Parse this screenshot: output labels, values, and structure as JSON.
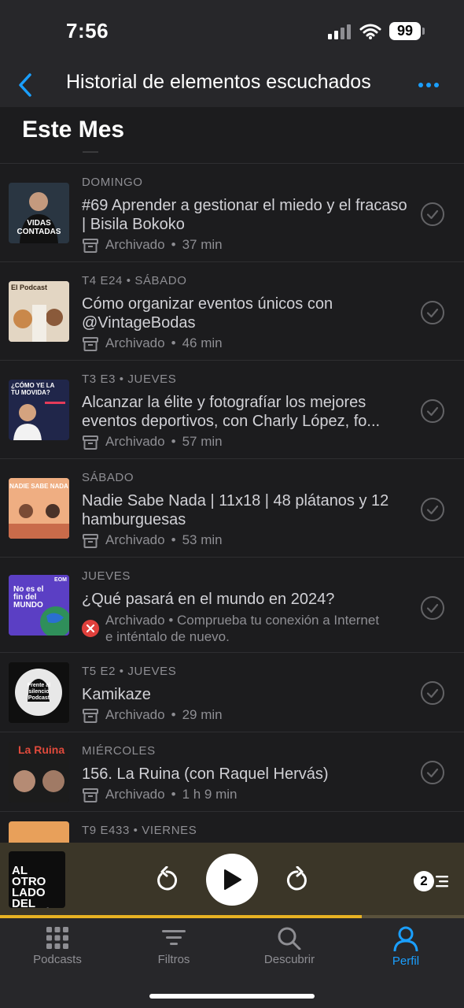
{
  "status_bar": {
    "time": "7:56",
    "battery": "99"
  },
  "nav": {
    "title": "Historial de elementos escuchados"
  },
  "section": {
    "title": "Este Mes"
  },
  "episodes": [
    {
      "meta": "DOMINGO",
      "title": "#69 Aprender a gestionar el miedo y el fracaso | Bisila Bokoko",
      "status": "Archivado",
      "duration": "37 min"
    },
    {
      "meta": "T4 E24 • SÁBADO",
      "title": "Cómo organizar eventos únicos con @VintageBodas",
      "status": "Archivado",
      "duration": "46 min"
    },
    {
      "meta": "T3 E3 • JUEVES",
      "title": "Alcanzar la élite y fotografíar los mejores eventos deportivos, con Charly López, fo...",
      "status": "Archivado",
      "duration": "57 min"
    },
    {
      "meta": "SÁBADO",
      "title": "Nadie Sabe Nada | 11x18 | 48 plátanos y 12 hamburguesas",
      "status": "Archivado",
      "duration": "53 min"
    },
    {
      "meta": "JUEVES",
      "title": "¿Qué pasará en el mundo en 2024?",
      "status": "Archivado",
      "error": "Comprueba tu conexión a Internet e inténtalo de nuevo."
    },
    {
      "meta": "T5 E2 • JUEVES",
      "title": "Kamikaze",
      "status": "Archivado",
      "duration": "29 min"
    },
    {
      "meta": "MIÉRCOLES",
      "title": "156. La Ruina (con Raquel Hervás)",
      "status": "Archivado",
      "duration": "1 h 9 min"
    },
    {
      "meta": "T9 E433 • VIERNES"
    }
  ],
  "artwork_text": {
    "ep1": "VIDAS CONTADAS",
    "ep2": "El Podcast",
    "ep3": "¿CÓMO YE LA TU MOVIDA?",
    "ep4": "NADIE SABE NADA",
    "ep5": "No es el fin del MUNDO",
    "ep5_badge": "EOM",
    "ep6": "Frente al silencio Podcast",
    "ep7": "La Ruina",
    "player": "AL OTRO LADO DEL MICRÓFONO"
  },
  "player": {
    "queue_count": "2",
    "progress": 0.78
  },
  "tabs": [
    {
      "label": "Podcasts",
      "icon": "grid-icon"
    },
    {
      "label": "Filtros",
      "icon": "filter-icon"
    },
    {
      "label": "Descubrir",
      "icon": "search-icon"
    },
    {
      "label": "Perfil",
      "icon": "profile-icon",
      "active": true
    }
  ],
  "colors": {
    "accent": "#1a9fff",
    "progress": "#e8b323",
    "error": "#e0403c"
  }
}
